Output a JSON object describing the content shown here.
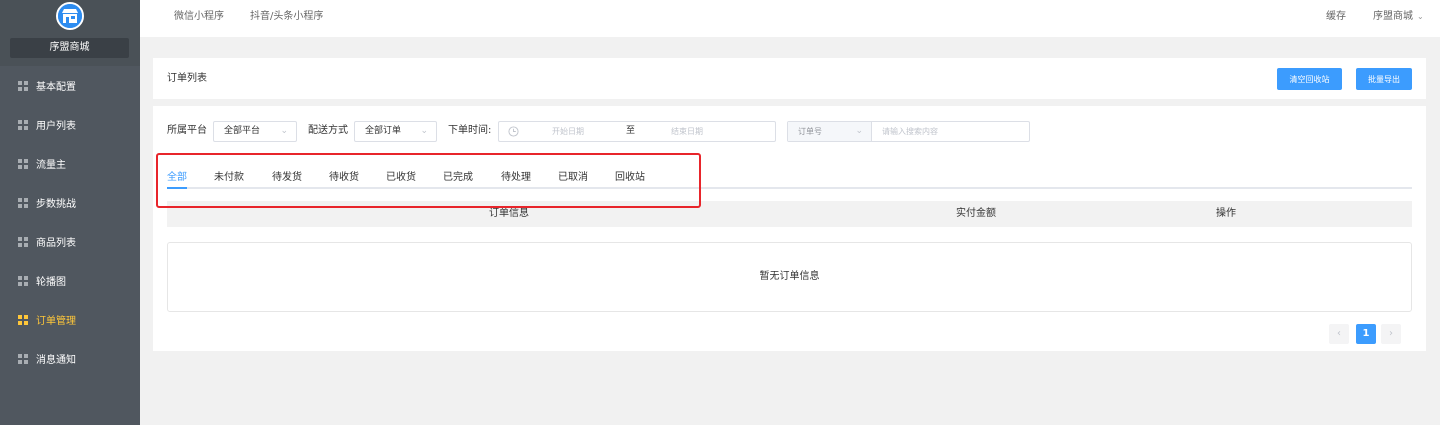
{
  "sidebar": {
    "brand": "序盟商城",
    "items": [
      {
        "label": "基本配置",
        "active": false
      },
      {
        "label": "用户列表",
        "active": false
      },
      {
        "label": "流量主",
        "active": false
      },
      {
        "label": "步数挑战",
        "active": false
      },
      {
        "label": "商品列表",
        "active": false
      },
      {
        "label": "轮播图",
        "active": false
      },
      {
        "label": "订单管理",
        "active": true
      },
      {
        "label": "消息通知",
        "active": false
      }
    ]
  },
  "header": {
    "tabs": [
      "微信小程序",
      "抖音/头条小程序"
    ],
    "cache": "缓存",
    "user": "序盟商城"
  },
  "title_bar": {
    "title": "订单列表",
    "clear_bin": "清空回收站",
    "export": "批量导出"
  },
  "filters": {
    "platform_label": "所属平台",
    "platform_value": "全部平台",
    "delivery_label": "配送方式",
    "delivery_value": "全部订单",
    "time_label": "下单时间:",
    "start_placeholder": "开始日期",
    "range_sep": "至",
    "end_placeholder": "结束日期",
    "search_field": "订单号",
    "search_placeholder": "请输入搜索内容"
  },
  "order_tabs": [
    "全部",
    "未付款",
    "待发货",
    "待收货",
    "已收货",
    "已完成",
    "待处理",
    "已取消",
    "回收站"
  ],
  "active_tab": 0,
  "table": {
    "columns": [
      "订单信息",
      "实付金额",
      "操作"
    ],
    "empty_text": "暂无订单信息"
  },
  "pagination": {
    "prev": "‹",
    "current": "1",
    "next": "›"
  },
  "colors": {
    "primary": "#3c9cfe",
    "sidebar": "#50575f",
    "active_menu": "#ffc73a",
    "highlight": "#e8252b"
  }
}
